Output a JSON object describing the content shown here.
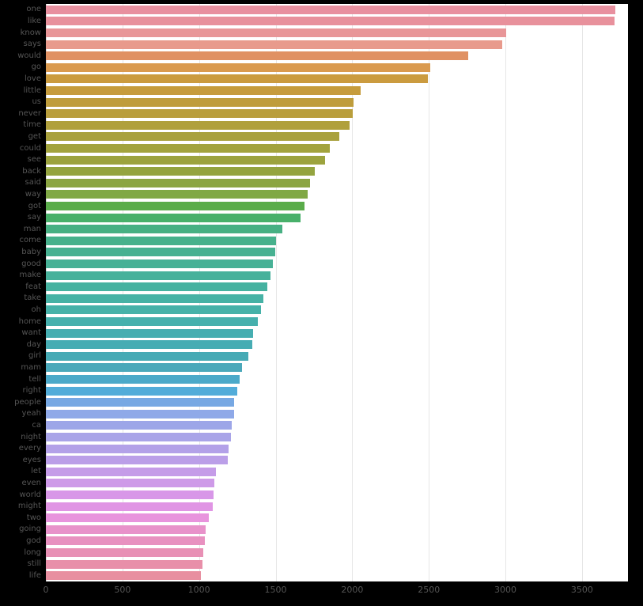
{
  "chart_data": {
    "type": "bar",
    "orientation": "horizontal",
    "title": "",
    "subtitle": "",
    "xlabel": "",
    "ylabel": "",
    "xlim": [
      0,
      3800
    ],
    "ylim": null,
    "grid": true,
    "grid_axis": "x",
    "legend": null,
    "legend_position": "none",
    "background": "#000000",
    "plot_background": "#ffffff",
    "gridline_color": "#e6e6e6",
    "tick_label_color": "#555555",
    "xticks": [
      0,
      500,
      1000,
      1500,
      2000,
      2500,
      3000,
      3500
    ],
    "xticklabels": [
      "0",
      "500",
      "1000",
      "1500",
      "2000",
      "2500",
      "3000",
      "3500"
    ],
    "categories": [
      "one",
      "like",
      "know",
      "says",
      "would",
      "go",
      "love",
      "little",
      "us",
      "never",
      "time",
      "get",
      "could",
      "see",
      "back",
      "said",
      "way",
      "got",
      "say",
      "man",
      "come",
      "baby",
      "good",
      "make",
      "feat",
      "take",
      "oh",
      "home",
      "want",
      "day",
      "girl",
      "mam",
      "tell",
      "right",
      "people",
      "yeah",
      "ca",
      "night",
      "every",
      "eyes",
      "let",
      "even",
      "world",
      "might",
      "two",
      "going",
      "god",
      "long",
      "still",
      "life"
    ],
    "values": [
      3717,
      3712,
      3005,
      2980,
      2755,
      2510,
      2495,
      2055,
      2010,
      2005,
      1985,
      1915,
      1855,
      1825,
      1755,
      1725,
      1710,
      1690,
      1660,
      1545,
      1500,
      1495,
      1480,
      1465,
      1445,
      1420,
      1405,
      1385,
      1355,
      1345,
      1320,
      1280,
      1265,
      1250,
      1230,
      1230,
      1215,
      1210,
      1195,
      1190,
      1110,
      1100,
      1095,
      1090,
      1065,
      1045,
      1040,
      1030,
      1020,
      1010
    ],
    "colors": [
      "#e8909f",
      "#e8919c",
      "#e89698",
      "#e89a8c",
      "#e09163",
      "#da9a4f",
      "#cb9b3f",
      "#c69c3d",
      "#bf9d3c",
      "#b99e3c",
      "#b0a03c",
      "#a9a13d",
      "#a2a33d",
      "#9ca33e",
      "#94a43f",
      "#8ba542",
      "#80a845",
      "#5aac4a",
      "#48b06a",
      "#47b083",
      "#47b18c",
      "#47b191",
      "#47b196",
      "#47b19b",
      "#46b2a0",
      "#46b2a5",
      "#46b2a9",
      "#46b0ad",
      "#46aeb1",
      "#46acb3",
      "#46aab5",
      "#4aa8ba",
      "#4ba9c9",
      "#52acd9",
      "#77a8e3",
      "#8fa9e8",
      "#9da6e8",
      "#a9a4e8",
      "#b3a1e8",
      "#bb9fe8",
      "#c59ce8",
      "#ce9ae8",
      "#d897e8",
      "#e095e4",
      "#e894dd",
      "#e892ca",
      "#e891c0",
      "#e890b5",
      "#e88fa9",
      "#e88fa0"
    ]
  },
  "axis": {
    "x_tick_label_prefix": "",
    "y_tick_label_prefix": ""
  }
}
